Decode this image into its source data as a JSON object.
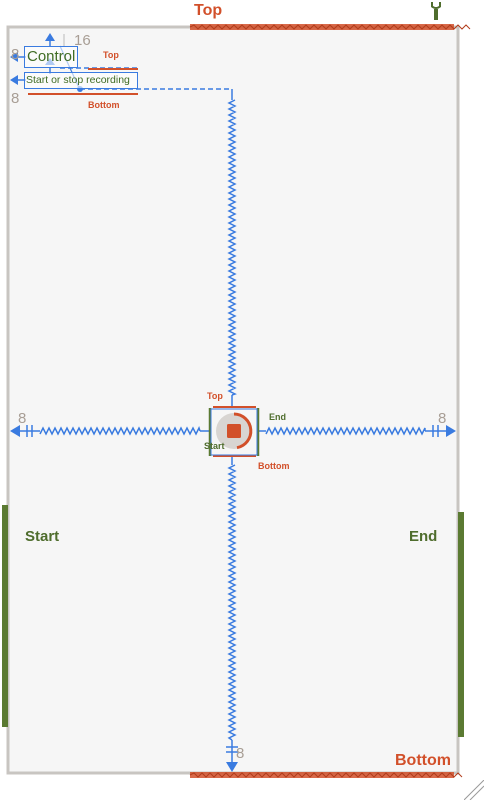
{
  "canvas_labels": {
    "top": "Top",
    "bottom": "Bottom",
    "start": "Start",
    "end": "End"
  },
  "header_controls": {
    "title_label": "Control",
    "subtitle_label": "Start or stop recording",
    "top_tag": "Top",
    "bottom_tag": "Bottom",
    "spacing_top": "16",
    "spacing_left": "8",
    "spacing_left_lower": "8"
  },
  "record_button": {
    "top_tag": "Top",
    "bottom_tag": "Bottom",
    "start_tag": "Start",
    "end_tag": "End"
  },
  "spacing_values": {
    "left": "8",
    "right": "8",
    "bottom": "8"
  },
  "icons": {
    "pin": "wrench-icon",
    "record": "stop-record-icon",
    "resize": "resize-grip-icon"
  },
  "colors": {
    "constraint_blue": "#3a7be0",
    "edge_orange": "#d2502a",
    "side_green": "#4f6d2d",
    "canvas_bg": "#f6f6f6"
  }
}
